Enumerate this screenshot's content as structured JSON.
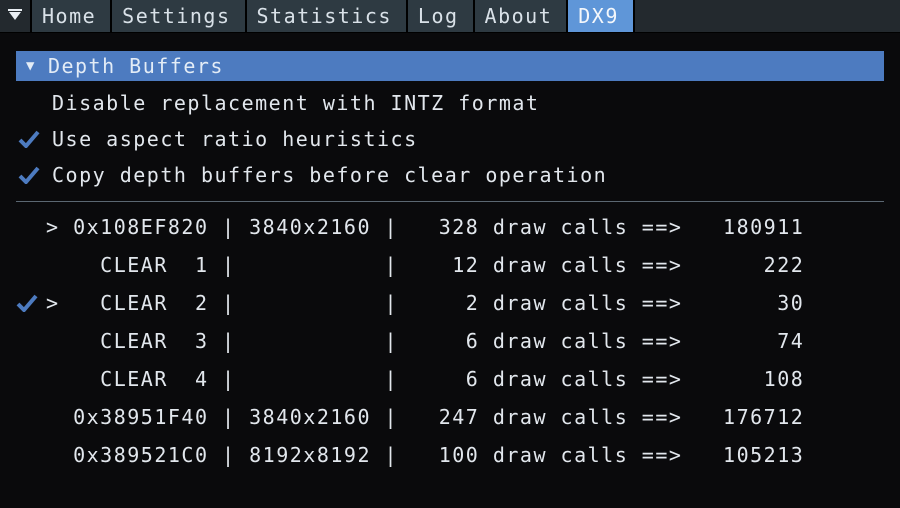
{
  "tabs": {
    "items": [
      {
        "label": "Home",
        "active": false
      },
      {
        "label": "Settings",
        "active": false
      },
      {
        "label": "Statistics",
        "active": false
      },
      {
        "label": "Log",
        "active": false
      },
      {
        "label": "About",
        "active": false
      },
      {
        "label": "DX9",
        "active": true
      }
    ]
  },
  "section": {
    "title": "Depth Buffers",
    "options": [
      {
        "label": "Disable replacement with INTZ format",
        "checked": false
      },
      {
        "label": "Use aspect ratio heuristics",
        "checked": true
      },
      {
        "label": "Copy depth buffers before clear operation",
        "checked": true
      }
    ]
  },
  "buffers": {
    "rows": [
      {
        "checked": false,
        "marker": ">",
        "name": "0x108EF820",
        "res": "3840x2160",
        "draws": 328,
        "value": 180911
      },
      {
        "checked": false,
        "marker": " ",
        "name": "CLEAR  1",
        "res": "",
        "draws": 12,
        "value": 222
      },
      {
        "checked": true,
        "marker": ">",
        "name": "CLEAR  2",
        "res": "",
        "draws": 2,
        "value": 30
      },
      {
        "checked": false,
        "marker": " ",
        "name": "CLEAR  3",
        "res": "",
        "draws": 6,
        "value": 74
      },
      {
        "checked": false,
        "marker": " ",
        "name": "CLEAR  4",
        "res": "",
        "draws": 6,
        "value": 108
      },
      {
        "checked": false,
        "marker": " ",
        "name": "0x38951F40",
        "res": "3840x2160",
        "draws": 247,
        "value": 176712
      },
      {
        "checked": false,
        "marker": " ",
        "name": "0x389521C0",
        "res": "8192x8192",
        "draws": 100,
        "value": 105213
      }
    ]
  }
}
